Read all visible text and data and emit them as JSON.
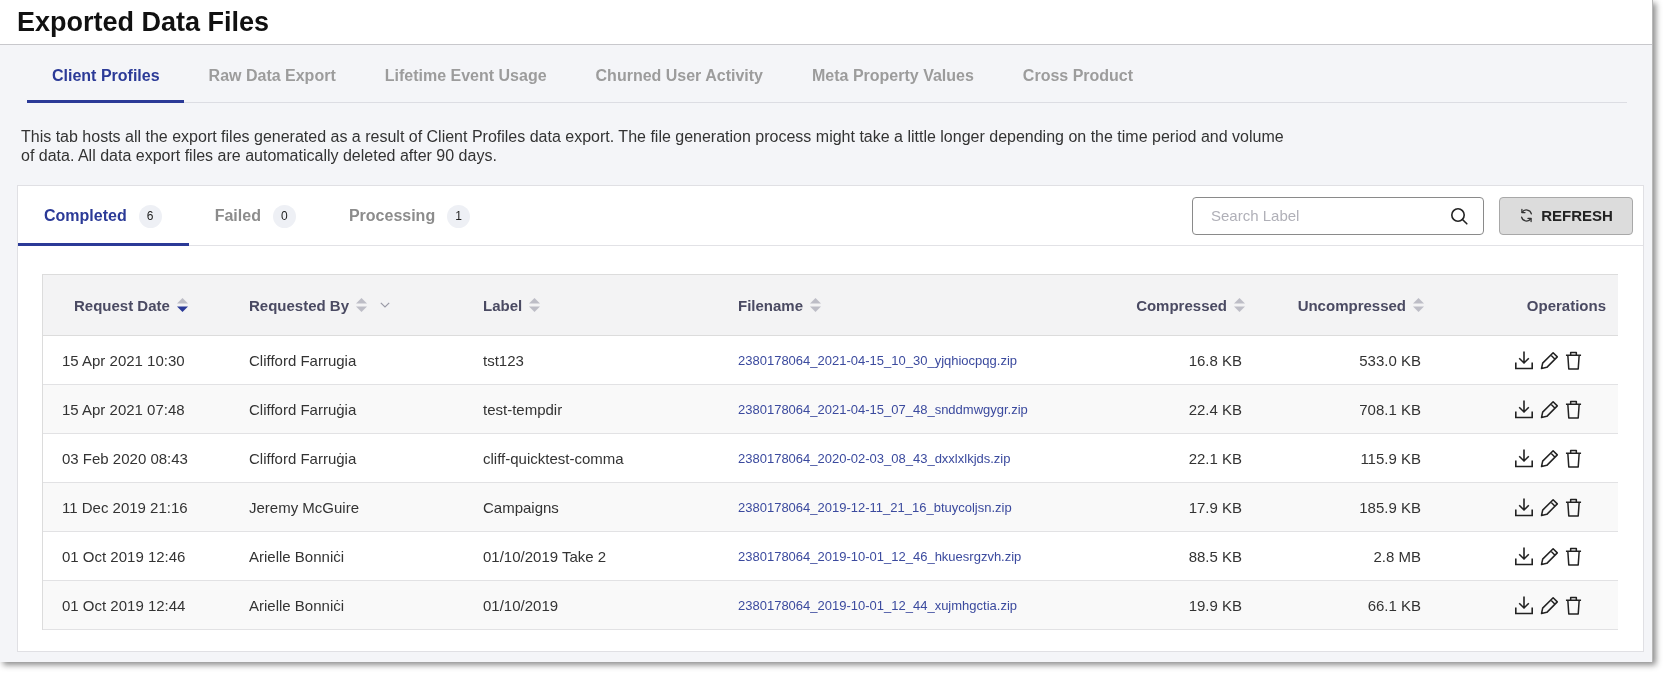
{
  "page": {
    "title": "Exported Data Files"
  },
  "tabs": [
    {
      "label": "Client Profiles",
      "selected": true
    },
    {
      "label": "Raw Data Export",
      "selected": false
    },
    {
      "label": "Lifetime Event Usage",
      "selected": false
    },
    {
      "label": "Churned User Activity",
      "selected": false
    },
    {
      "label": "Meta Property Values",
      "selected": false
    },
    {
      "label": "Cross Product",
      "selected": false
    }
  ],
  "description": "This tab hosts all the export files generated as a result of Client Profiles data export. The file generation process might take a little longer depending on the time period and volume of data. All data export files are automatically deleted after 90 days.",
  "status_tabs": [
    {
      "label": "Completed",
      "count": "6",
      "selected": true
    },
    {
      "label": "Failed",
      "count": "0",
      "selected": false
    },
    {
      "label": "Processing",
      "count": "1",
      "selected": false
    }
  ],
  "search": {
    "placeholder": "Search Label"
  },
  "refresh_button": {
    "label": "REFRESH"
  },
  "table": {
    "columns": [
      {
        "label": "Request Date",
        "kind": "date",
        "sorted": true,
        "filter": false
      },
      {
        "label": "Requested By",
        "kind": "text",
        "sorted": false,
        "filter": true
      },
      {
        "label": "Label",
        "kind": "text",
        "sorted": false,
        "filter": false
      },
      {
        "label": "Filename",
        "kind": "link",
        "sorted": false,
        "filter": false
      },
      {
        "label": "Compressed",
        "kind": "size",
        "sorted": false,
        "filter": false
      },
      {
        "label": "Uncompressed",
        "kind": "size",
        "sorted": false,
        "filter": false
      },
      {
        "label": "Operations",
        "kind": "actions",
        "filter": false
      }
    ],
    "rows": [
      {
        "cells": [
          "15 Apr 2021 10:30",
          "Clifford Farrugia",
          "tst123",
          "2380178064_2021-04-15_10_30_yjqhiocpqg.zip",
          "16.8 KB",
          "533.0 KB"
        ]
      },
      {
        "cells": [
          "15 Apr 2021 07:48",
          "Clifford Farruġia",
          "test-tempdir",
          "2380178064_2021-04-15_07_48_snddmwgygr.zip",
          "22.4 KB",
          "708.1 KB"
        ]
      },
      {
        "cells": [
          "03 Feb 2020 08:43",
          "Clifford Farruġia",
          "cliff-quicktest-comma",
          "2380178064_2020-02-03_08_43_dxxlxlkjds.zip",
          "22.1 KB",
          "115.9 KB"
        ]
      },
      {
        "cells": [
          "11 Dec 2019 21:16",
          "Jeremy McGuire",
          "Campaigns",
          "2380178064_2019-12-11_21_16_btuycoljsn.zip",
          "17.9 KB",
          "185.9 KB"
        ]
      },
      {
        "cells": [
          "01 Oct 2019 12:46",
          "Arielle Bonniċi",
          "01/10/2019 Take 2",
          "2380178064_2019-10-01_12_46_hkuesrgzvh.zip",
          "88.5 KB",
          "2.8 MB"
        ]
      },
      {
        "cells": [
          "01 Oct 2019 12:44",
          "Arielle Bonniċi",
          "01/10/2019",
          "2380178064_2019-10-01_12_44_xujmhgctia.zip",
          "19.9 KB",
          "66.1 KB"
        ]
      }
    ]
  }
}
